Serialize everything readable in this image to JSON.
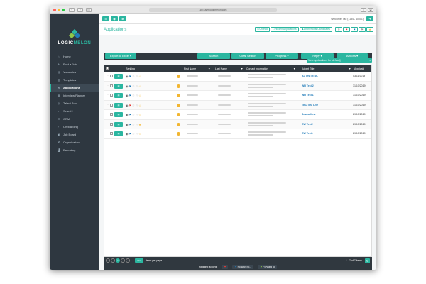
{
  "browser": {
    "url": "app.user.logicmelon.com"
  },
  "sidebar": {
    "logo_part1": "LOGIC",
    "logo_part2": "MELON",
    "items": [
      {
        "label": "Home",
        "icon": "home-icon",
        "glyph": "⌂"
      },
      {
        "label": "Post a Job",
        "icon": "post-icon",
        "glyph": "✈"
      },
      {
        "label": "Vacancies",
        "icon": "vacancies-icon",
        "glyph": "▤"
      },
      {
        "label": "Templates",
        "icon": "templates-icon",
        "glyph": "▥"
      },
      {
        "label": "Applications",
        "icon": "applications-icon",
        "glyph": "✉"
      },
      {
        "label": "Interview Planner",
        "icon": "calendar-icon",
        "glyph": "▦"
      },
      {
        "label": "Talent Pool",
        "icon": "talent-icon",
        "glyph": "◎"
      },
      {
        "label": "Search+",
        "icon": "search-icon",
        "glyph": "⌕"
      },
      {
        "label": "CRM",
        "icon": "crm-icon",
        "glyph": "☰"
      },
      {
        "label": "Onboarding",
        "icon": "onboarding-icon",
        "glyph": "✓"
      },
      {
        "label": "Job Board",
        "icon": "board-icon",
        "glyph": "▣"
      },
      {
        "label": "Organisation",
        "icon": "org-icon",
        "glyph": "⌘"
      },
      {
        "label": "Reporting",
        "icon": "report-icon",
        "glyph": "▟"
      }
    ]
  },
  "topbar": {
    "welcome": "Welcome, Tad (1134 - 40001)"
  },
  "header": {
    "title": "Applications",
    "filters": [
      "Unread",
      "Hidden Applications",
      "Anonymous Candidates"
    ]
  },
  "toolbar": {
    "export": "Export to Excel",
    "search": "Search",
    "clear": "Clear Search",
    "progress": "Progress",
    "reply": "Reply",
    "actions": "Actions",
    "view": "View applications for [default]"
  },
  "grid": {
    "columns": {
      "ranking": "Ranking",
      "first": "First Name",
      "last": "Last Name",
      "contact": "Contact Information",
      "advert": "Advert Title",
      "applied": "Applicati"
    },
    "rows": [
      {
        "advert": "BJ Test HTML",
        "date": "03/11/2019"
      },
      {
        "advert": "WH Test 2",
        "date": "31/10/2019"
      },
      {
        "advert": "WH Test 1",
        "date": "31/10/2019"
      },
      {
        "advert": "TBC Test Live",
        "date": "31/10/2019"
      },
      {
        "advert": "Sesmailtest",
        "date": "29/10/2019"
      },
      {
        "advert": "CW Test2",
        "date": "29/10/2019"
      },
      {
        "advert": "CW Test1",
        "date": "29/10/2019"
      }
    ]
  },
  "pager": {
    "current": "1",
    "page_size": "10",
    "items_label": "items per page",
    "info": "1 - 7 of 7 items"
  },
  "flagbar": {
    "label": "Flagging actions:",
    "fwd1": "Forward to...",
    "fwd2": "Forward to"
  },
  "colors": {
    "accent": "#2bb6a0",
    "dark": "#30383f",
    "link": "#1f7ab8"
  }
}
